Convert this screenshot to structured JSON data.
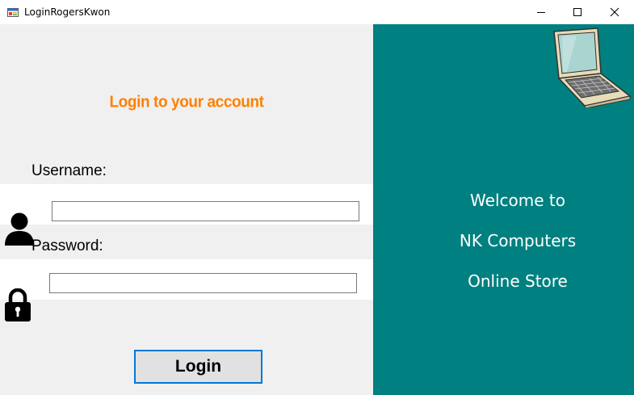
{
  "window": {
    "title": "LoginRogersKwon",
    "app_icon": "winforms-app-icon",
    "controls": {
      "minimize": "minimize-icon",
      "maximize": "maximize-icon",
      "close": "close-icon"
    }
  },
  "login": {
    "heading": "Login to your account",
    "username_label": "Username:",
    "username_value": "",
    "password_label": "Password:",
    "password_value": "",
    "button_label": "Login",
    "user_icon": "user-icon",
    "lock_icon": "lock-icon"
  },
  "welcome": {
    "line1": "Welcome to",
    "line2": "NK Computers",
    "line3": "Online Store",
    "image": "laptop-icon"
  },
  "colors": {
    "left_bg": "#f0f0f0",
    "right_bg": "#008080",
    "heading": "#ff8000",
    "button_border": "#0078d7"
  }
}
